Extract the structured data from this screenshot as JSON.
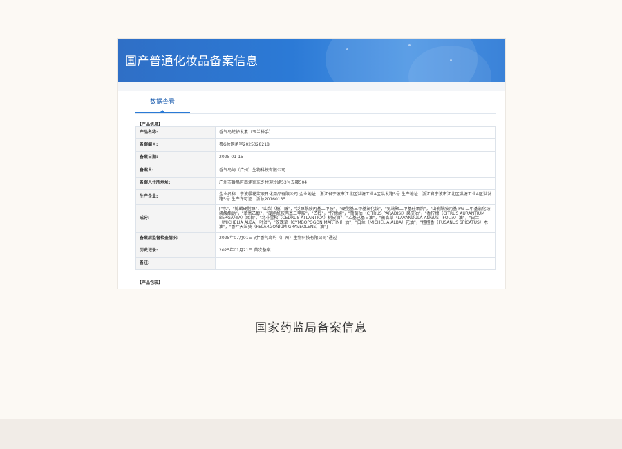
{
  "header": {
    "title": "国产普通化妆品备案信息"
  },
  "tabs": [
    {
      "label": "数据查看"
    }
  ],
  "sections": {
    "product_info": "【产品信息】",
    "product_packaging": "【产品包装】"
  },
  "rows": [
    {
      "label": "产品名称:",
      "value": "香气岛蛇护发素（玉兰禅手）"
    },
    {
      "label": "备案编号:",
      "value": "粤G妆网备字2025028218"
    },
    {
      "label": "备案日期:",
      "value": "2025-01-15"
    },
    {
      "label": "备案人:",
      "value": "香气岛屿（广州）生物科技有限公司"
    },
    {
      "label": "备案人住所地址:",
      "value": "广州市番禺区南浦街东乡村迎沙路53号五楼504"
    },
    {
      "label": "生产企业:",
      "value": "企业名称：宁波樱花浆液日化用品有限公司 企业地址：浙江省宁波市江北区洪塘工业A区洪发路5号 生产地址：浙江省宁波市江北区洪塘工业A区洪发路5号 生产许可证：浙妆20160135"
    },
    {
      "label": "成分:",
      "value": "[\"水\"，\"鲸蜡硬脂醇\"，\"山梨（糖）醇\"，\"泛醇酰胺丙基二甲胺\"，\"硬脂基三甲基氯化铵\"，\"氨端聚二甲基硅氧烷\"，\"山嵛酰胺丙基 PG-二甲基氯化铵磷酸酯钠\"，\"苯氧乙醇\"，\"硬脂酰胺丙基二甲胺\"，\"乙醇\"，\"柠檬酸\"，\"葡萄柚（CITRUS PARADISI）果皮油\"，\"香柠檬（CITRUS AURANTIUM BERGAMIA）果油\"，\"北非雪松（CEDRUS ATLANTICA）树皮油\"，\"乙基己基甘油\"，\"薰衣草（LAVANDULA ANGUSTIFOLIA）油\"，\"白兰（MICHELIA ALBA）叶油\"，\"玫瑰草（CYMBOPOGON MARTINI）油\"，\"白兰（MICHELIA ALBA）花油\"，\"檀檀香（FUSANUS SPICATUS）木油\"，\"香叶天竺葵（PELARGONIUM GRAVEOLENS）油\"]"
    },
    {
      "label": "备案后监督检查情况:",
      "value": "2025年07月01日 对“香气岛屿（广州）生物科技有限公司”通过"
    },
    {
      "label": "历史记录:",
      "value": "2025年01月21日 首次备案"
    },
    {
      "label": "备注:",
      "value": ""
    }
  ],
  "caption": "国家药监局备案信息",
  "colors": {
    "banner": "#2c7ad6",
    "tab_accent": "#2a7ad6",
    "background": "#fcf9f4"
  }
}
